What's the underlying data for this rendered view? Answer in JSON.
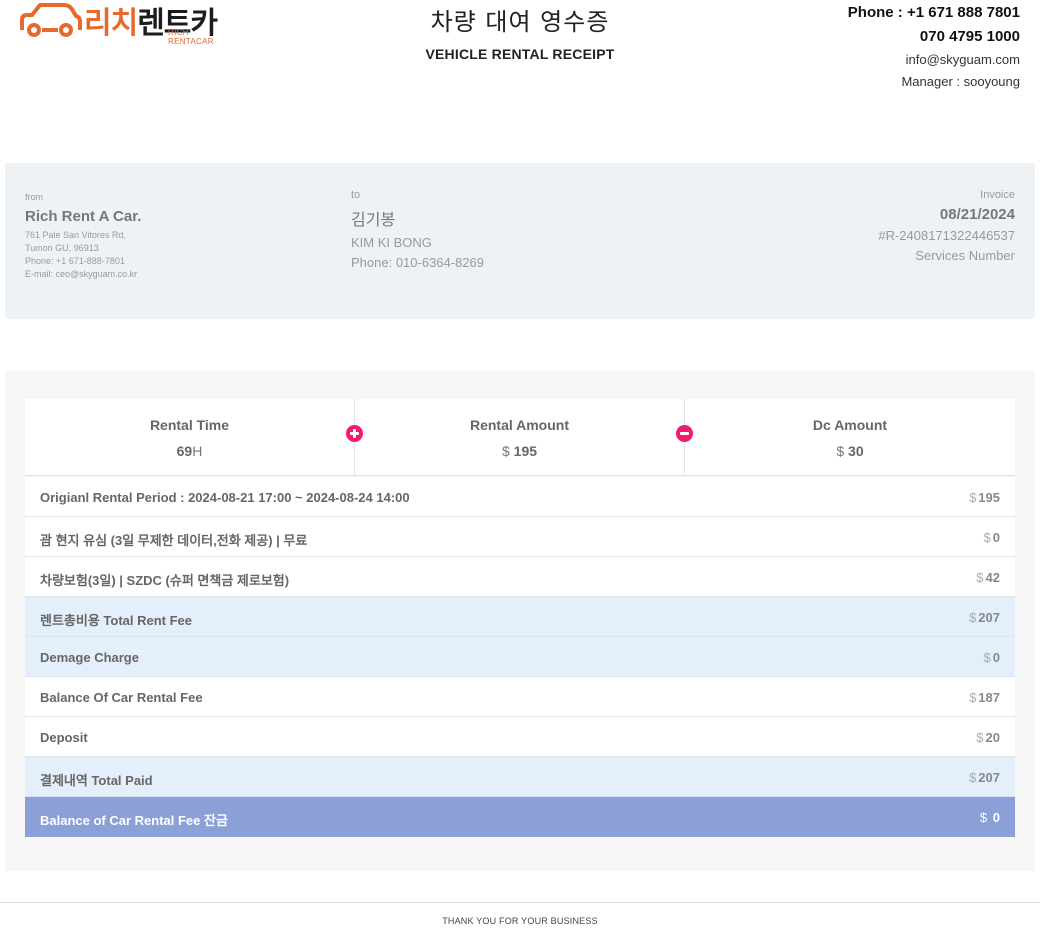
{
  "brand": {
    "logo_text_orange": "리치",
    "logo_text_dark": "렌트카",
    "logo_sub": "RICH RENTACAR",
    "accent_color": "#e8692c"
  },
  "header": {
    "title_ko": "차량 대여 영수증",
    "title_en": "VEHICLE RENTAL RECEIPT"
  },
  "contact": {
    "phone1": "Phone : +1 671 888 7801",
    "phone2": "070 4795 1000",
    "email": "info@skyguam.com",
    "manager": "Manager : sooyoung"
  },
  "from": {
    "label": "from",
    "name": "Rich Rent A Car.",
    "address1": "761 Pale San Vitores Rd,",
    "address2": "Tumon GU, 96913",
    "phone": "Phone: +1 671-888-7801",
    "email": "E-mail: ceo@skyguam.co.kr"
  },
  "to": {
    "label": "to",
    "name_ko": "김기봉",
    "name_en": "KIM KI BONG",
    "phone": "Phone: 010-6364-8269"
  },
  "invoice": {
    "label": "Invoice",
    "date": "08/21/2024",
    "number": "#R-2408171322446537",
    "services": "Services Number"
  },
  "summary": {
    "rental_time_label": "Rental Time",
    "rental_time_value": "69",
    "rental_time_unit": "H",
    "rental_amount_label": "Rental Amount",
    "rental_amount_currency": "$",
    "rental_amount_value": "195",
    "dc_amount_label": "Dc Amount",
    "dc_amount_currency": "$",
    "dc_amount_value": "30",
    "plus_icon": "plus-circle-icon",
    "minus_icon": "minus-circle-icon",
    "icon_color": "#ef1a71"
  },
  "rows": [
    {
      "label": "Origianl Rental Period : 2024-08-21 17:00 ~ 2024-08-24 14:00",
      "currency": "$",
      "amount": "195"
    },
    {
      "label": "괌 현지 유심 (3일 무제한 데이터,전화 제공) | 무료",
      "currency": "$",
      "amount": "0"
    },
    {
      "label": "차량보험(3일) | SZDC (슈퍼 면책금 제로보험)",
      "currency": "$",
      "amount": "42"
    },
    {
      "label": "렌트총비용 Total Rent Fee",
      "currency": "$",
      "amount": "207"
    },
    {
      "label": "Demage Charge",
      "currency": "$",
      "amount": "0"
    },
    {
      "label": "Balance Of Car Rental Fee",
      "currency": "$",
      "amount": "187"
    },
    {
      "label": "Deposit",
      "currency": "$",
      "amount": "20"
    },
    {
      "label": "결제내역 Total Paid",
      "currency": "$",
      "amount": "207"
    },
    {
      "label": "Balance of Car Rental Fee 잔금",
      "currency": "$",
      "amount": "0"
    }
  ],
  "colors": {
    "highlight_row": "#e4effc",
    "total_row": "#8aa0d6"
  },
  "footer": {
    "text": "THANK YOU FOR YOUR BUSINESS"
  }
}
